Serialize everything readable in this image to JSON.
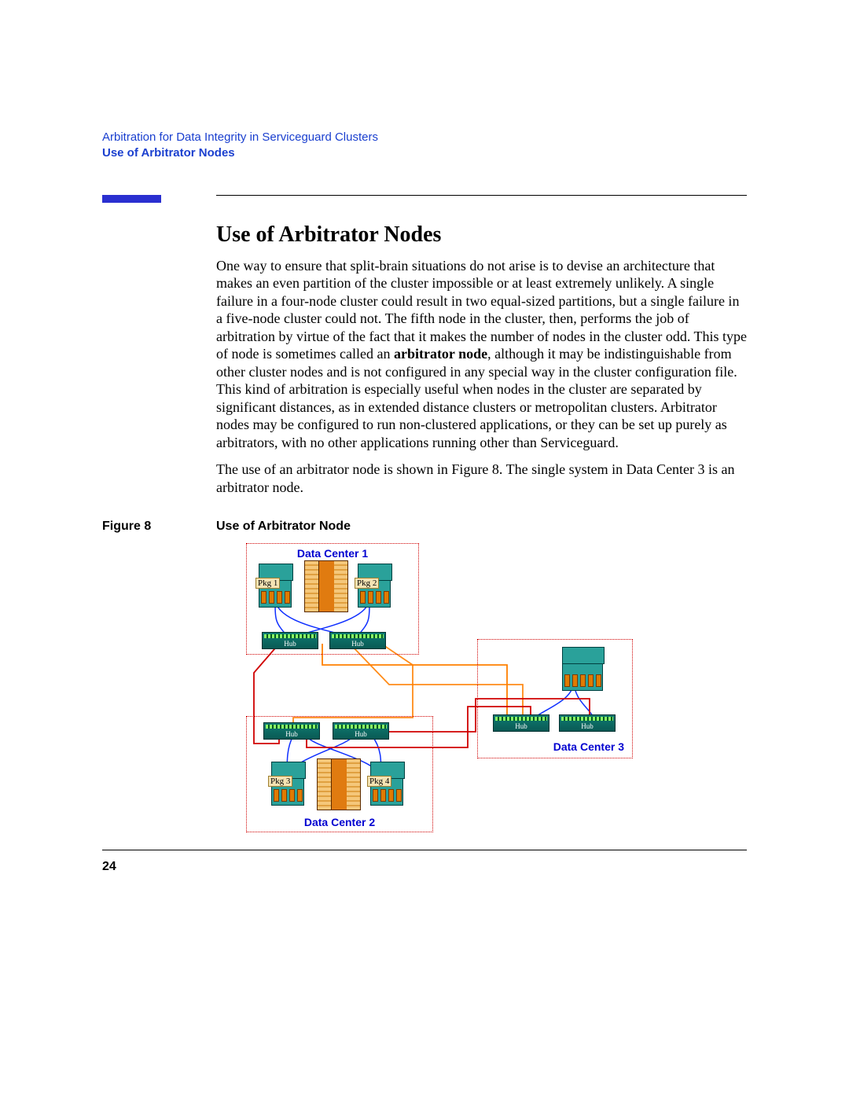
{
  "header": {
    "chapter": "Arbitration for Data Integrity in Serviceguard Clusters",
    "section": "Use of Arbitrator Nodes"
  },
  "title": "Use of Arbitrator Nodes",
  "paragraphs": {
    "p1a": "One way to ensure that split-brain situations do not arise is to devise an architecture that makes an even partition of the cluster impossible or at least extremely unlikely. A single failure in a four-node cluster could result in two equal-sized partitions, but a single failure in a five-node cluster could not. The fifth node in the cluster, then, performs the job of arbitration by virtue of the fact that it makes the number of nodes in the cluster odd. This type of node is sometimes called an ",
    "p1bold": "arbitrator node",
    "p1b": ", although it may be indistinguishable from other cluster nodes and is not configured in any special way in the cluster configuration file. This kind of arbitration is especially useful when nodes in the cluster are separated by significant distances, as in extended distance clusters or metropolitan clusters. Arbitrator nodes may be configured to run non-clustered applications, or they can be set up purely as arbitrators, with no other applications running other than Serviceguard.",
    "p2": "The use of an arbitrator node is shown in Figure 8. The single system in Data Center 3 is an arbitrator node."
  },
  "figure": {
    "label": "Figure  8",
    "caption": "Use of Arbitrator Node",
    "dc1": "Data Center 1",
    "dc2": "Data Center 2",
    "dc3": "Data Center 3",
    "pkg1": "Pkg 1",
    "pkg2": "Pkg 2",
    "pkg3": "Pkg 3",
    "pkg4": "Pkg 4",
    "hub": "Hub"
  },
  "pageNumber": "24"
}
